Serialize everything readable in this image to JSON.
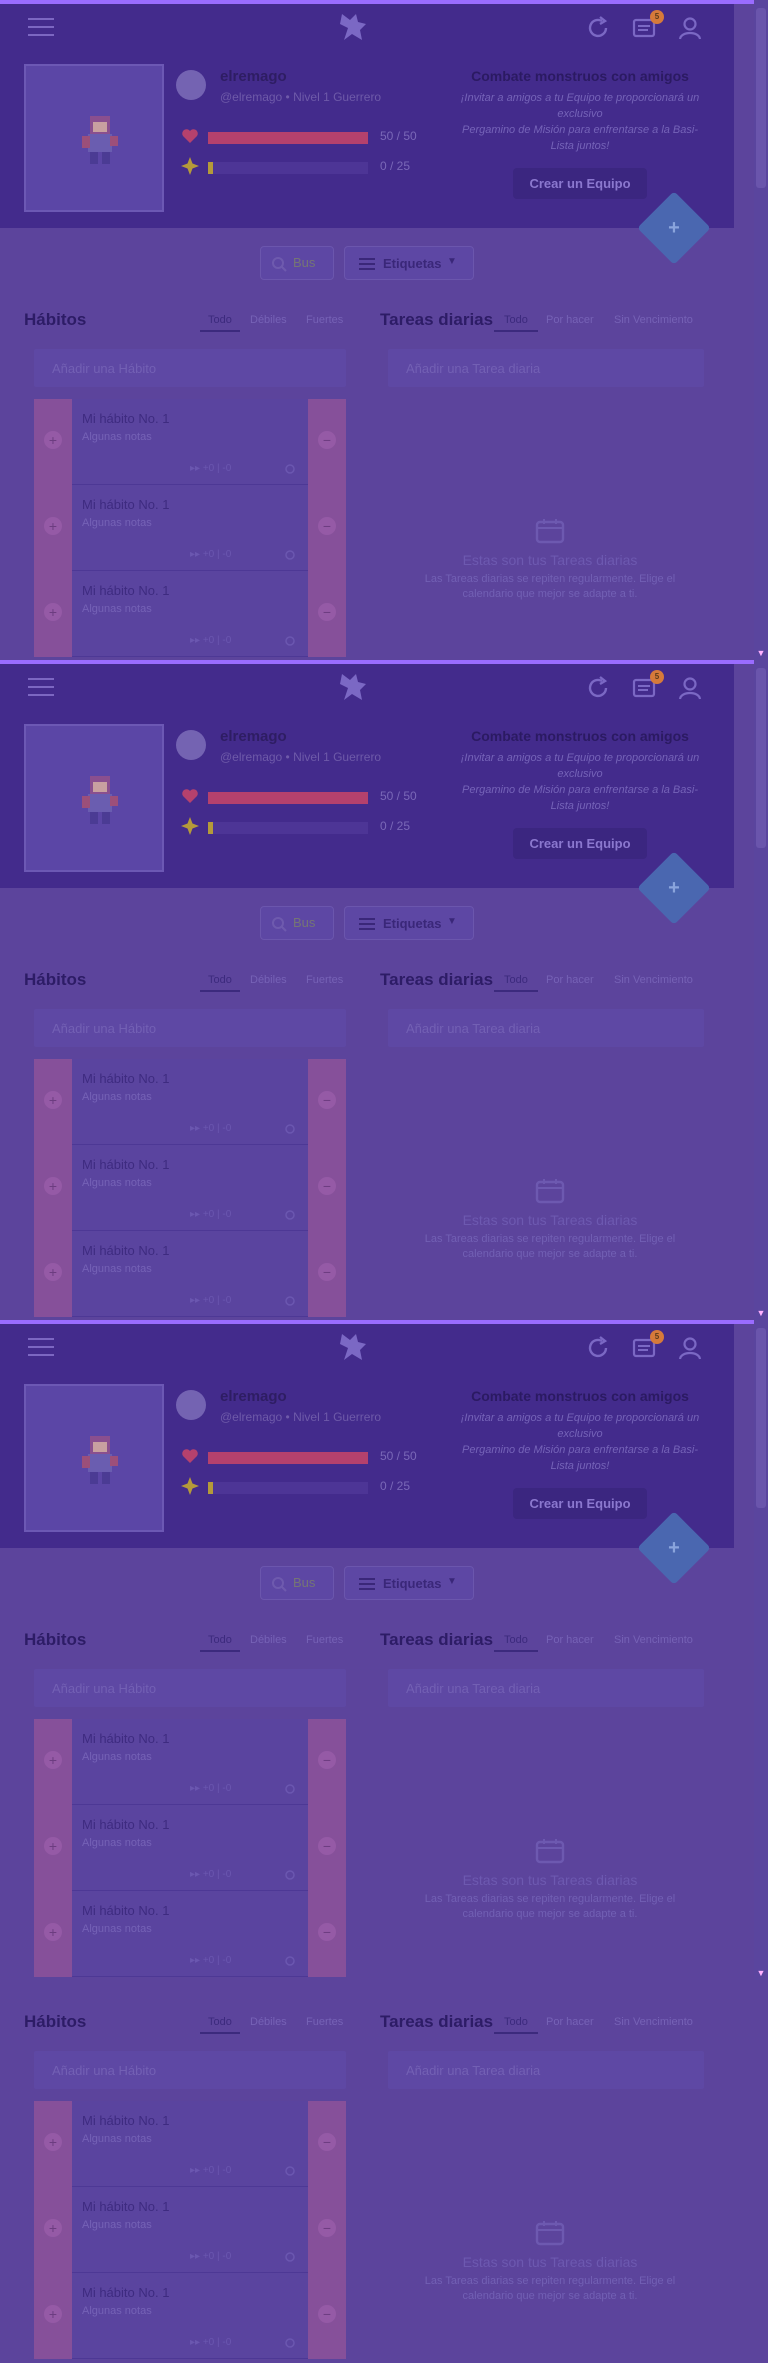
{
  "header": {
    "username": "elremago",
    "usertag": "@elremago • Nivel 1 Guerrero",
    "hp": {
      "text": "50 / 50",
      "fill": 1.0
    },
    "xp": {
      "text": "0 / 25",
      "fill": 0.03
    },
    "notifications_count": "5",
    "party": {
      "title": "Combate monstruos con amigos",
      "line1": "¡Invitar a amigos a tu Equipo te proporcionará un",
      "line2": "exclusivo",
      "line3": "Pergamino de Misión para enfrentarse a la Basi-",
      "line4": "Lista juntos!",
      "button": "Crear un Equipo"
    }
  },
  "filters": {
    "search_placeholder": "Bus",
    "tags_label": "Etiquetas"
  },
  "habits": {
    "title": "Hábitos",
    "tabs": [
      "Todo",
      "Débiles",
      "Fuertes"
    ],
    "add_placeholder": "Añadir una Hábito",
    "items": [
      {
        "title": "Mi hábito No. 1",
        "notes": "Algunas notas",
        "counter": "▸▸ +0 | -0"
      },
      {
        "title": "Mi hábito No. 1",
        "notes": "Algunas notas",
        "counter": "▸▸ +0 | -0"
      },
      {
        "title": "Mi hábito No. 1",
        "notes": "Algunas notas",
        "counter": "▸▸ +0 | -0"
      }
    ]
  },
  "dailies": {
    "title": "Tareas diarias",
    "tabs": [
      "Todo",
      "Por hacer",
      "Sin Vencimiento"
    ],
    "add_placeholder": "Añadir una Tarea diaria",
    "empty_title": "Estas son tus Tareas diarias",
    "empty_desc": "Las Tareas diarias se repiten regularmente. Elige el calendario que mejor se adapte a ti."
  },
  "colors": {
    "accent": "#9a6cff",
    "header_bg": "#432b8c",
    "page_bg": "#5c449c"
  }
}
